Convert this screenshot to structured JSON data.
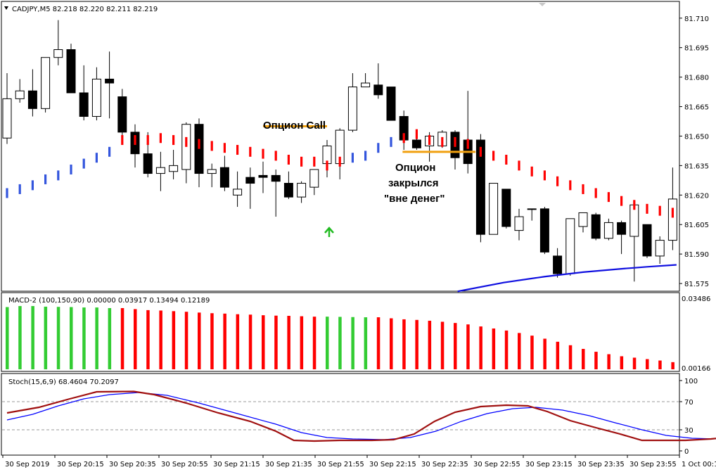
{
  "main": {
    "header": "CADJPY,M5  82.218 82.220 82.211 82.219",
    "menu_icon": "triangle-down-icon",
    "y_ticks": [
      "81.710",
      "81.695",
      "81.680",
      "81.665",
      "81.650",
      "81.635",
      "81.620",
      "81.605",
      "81.590",
      "81.575"
    ],
    "ylim": [
      81.5718,
      81.7178
    ],
    "annotations": {
      "call": "Опцион Call",
      "closed_line1": "Опцион",
      "closed_line2": "закрылся",
      "closed_line3": "\"вне денег\""
    },
    "arrow_icon": "green-up-arrow-icon"
  },
  "macd": {
    "header": "MACD-2 (100,150,90) 0.00000 0.03917 0.13494 0.12189",
    "y_top": "0.03486",
    "y_bottom": "0.00166",
    "colors": {
      "up": "#33cc33",
      "down": "#ff0000"
    }
  },
  "stoch": {
    "header": "Stoch(15,6,9) 68.4604 70.2097",
    "y_ticks": [
      "100",
      "70",
      "30",
      "0"
    ],
    "colors": {
      "main": "#a01010",
      "signal": "#0000ff"
    }
  },
  "time_axis": {
    "labels": [
      "30 Sep 2019",
      "30 Sep 20:15",
      "30 Sep 20:35",
      "30 Sep 20:55",
      "30 Sep 21:15",
      "30 Sep 21:35",
      "30 Sep 21:55",
      "30 Sep 22:15",
      "30 Sep 22:35",
      "30 Sep 22:55",
      "30 Sep 23:15",
      "30 Sep 23:35",
      "30 Sep 23:55",
      "1 Oct 00:1"
    ]
  },
  "chart_data": [
    {
      "type": "candlestick",
      "symbol": "CADJPY",
      "timeframe": "M5",
      "ohlc": [
        [
          81.649,
          81.682,
          81.646,
          81.669
        ],
        [
          81.669,
          81.679,
          81.667,
          81.673
        ],
        [
          81.673,
          81.684,
          81.66,
          81.664
        ],
        [
          81.664,
          81.69,
          81.662,
          81.69
        ],
        [
          81.69,
          81.709,
          81.686,
          81.694
        ],
        [
          81.694,
          81.697,
          81.672,
          81.672
        ],
        [
          81.672,
          81.686,
          81.658,
          81.66
        ],
        [
          81.66,
          81.685,
          81.658,
          81.679
        ],
        [
          81.679,
          81.693,
          81.659,
          81.677
        ],
        [
          81.67,
          81.674,
          81.646,
          81.652
        ],
        [
          81.652,
          81.656,
          81.634,
          81.641
        ],
        [
          81.641,
          81.652,
          81.629,
          81.631
        ],
        [
          81.631,
          81.642,
          81.622,
          81.634
        ],
        [
          81.632,
          81.643,
          81.628,
          81.635
        ],
        [
          81.633,
          81.657,
          81.626,
          81.656
        ],
        [
          81.656,
          81.659,
          81.624,
          81.631
        ],
        [
          81.631,
          81.636,
          81.624,
          81.633
        ],
        [
          81.634,
          81.64,
          81.622,
          81.624
        ],
        [
          81.62,
          81.632,
          81.614,
          81.623
        ],
        [
          81.629,
          81.634,
          81.613,
          81.626
        ],
        [
          81.63,
          81.637,
          81.621,
          81.629
        ],
        [
          81.63,
          81.633,
          81.609,
          81.627
        ],
        [
          81.626,
          81.632,
          81.618,
          81.619
        ],
        [
          81.619,
          81.627,
          81.616,
          81.626
        ],
        [
          81.624,
          81.633,
          81.62,
          81.633
        ],
        [
          81.636,
          81.648,
          81.629,
          81.645
        ],
        [
          81.636,
          81.654,
          81.628,
          81.653
        ],
        [
          81.653,
          81.682,
          81.652,
          81.675
        ],
        [
          81.675,
          81.682,
          81.677,
          81.677
        ],
        [
          81.676,
          81.687,
          81.669,
          81.671
        ],
        [
          81.675,
          81.675,
          81.658,
          81.658
        ],
        [
          81.66,
          81.663,
          81.643,
          81.648
        ],
        [
          81.648,
          81.649,
          81.643,
          81.644
        ],
        [
          81.645,
          81.652,
          81.637,
          81.65
        ],
        [
          81.645,
          81.653,
          81.644,
          81.652
        ],
        [
          81.652,
          81.653,
          81.633,
          81.639
        ],
        [
          81.648,
          81.673,
          81.631,
          81.636
        ],
        [
          81.648,
          81.651,
          81.596,
          81.6
        ],
        [
          81.6,
          81.626,
          81.6,
          81.626
        ],
        [
          81.623,
          81.623,
          81.603,
          81.604
        ],
        [
          81.602,
          81.613,
          81.597,
          81.609
        ],
        [
          81.613,
          81.613,
          81.607,
          81.613
        ],
        [
          81.613,
          81.614,
          81.59,
          81.591
        ],
        [
          81.589,
          81.593,
          81.578,
          81.58
        ],
        [
          81.58,
          81.608,
          81.579,
          81.608
        ],
        [
          81.604,
          81.611,
          81.601,
          81.611
        ],
        [
          81.61,
          81.611,
          81.597,
          81.598
        ],
        [
          81.598,
          81.608,
          81.597,
          81.606
        ],
        [
          81.606,
          81.607,
          81.59,
          81.6
        ],
        [
          81.599,
          81.613,
          81.576,
          81.615
        ],
        [
          81.605,
          81.605,
          81.588,
          81.589
        ],
        [
          81.589,
          81.599,
          81.585,
          81.597
        ],
        [
          81.597,
          81.634,
          81.592,
          81.618
        ]
      ],
      "psar": [
        [
          0,
          81.621
        ],
        [
          1,
          81.623
        ],
        [
          2,
          81.625
        ],
        [
          3,
          81.628
        ],
        [
          4,
          81.63
        ],
        [
          5,
          81.633
        ],
        [
          6,
          81.636
        ],
        [
          7,
          81.639
        ],
        [
          8,
          81.642
        ],
        [
          9,
          81.648
        ],
        [
          10,
          81.648
        ],
        [
          11,
          81.648
        ],
        [
          12,
          81.649
        ],
        [
          13,
          81.648
        ],
        [
          14,
          81.647
        ],
        [
          15,
          81.646
        ],
        [
          16,
          81.645
        ],
        [
          17,
          81.644
        ],
        [
          18,
          81.643
        ],
        [
          19,
          81.642
        ],
        [
          20,
          81.641
        ],
        [
          21,
          81.64
        ],
        [
          22,
          81.638
        ],
        [
          23,
          81.637
        ],
        [
          24,
          81.637
        ],
        [
          25,
          81.635
        ],
        [
          26,
          81.637
        ],
        [
          27,
          81.639
        ],
        [
          28,
          81.64
        ],
        [
          29,
          81.644
        ],
        [
          30,
          81.647
        ],
        [
          31,
          81.649
        ],
        [
          32,
          81.651
        ],
        [
          33,
          81.648
        ],
        [
          34,
          81.647
        ],
        [
          35,
          81.647
        ],
        [
          36,
          81.646
        ],
        [
          37,
          81.642
        ],
        [
          38,
          81.64
        ],
        [
          39,
          81.638
        ],
        [
          40,
          81.635
        ],
        [
          41,
          81.632
        ],
        [
          42,
          81.63
        ],
        [
          43,
          81.627
        ],
        [
          44,
          81.625
        ],
        [
          45,
          81.623
        ],
        [
          46,
          81.621
        ],
        [
          47,
          81.619
        ],
        [
          48,
          81.617
        ],
        [
          49,
          81.615
        ],
        [
          50,
          81.613
        ],
        [
          51,
          81.612
        ],
        [
          52,
          81.611
        ]
      ],
      "psar_colors": {
        "below": "#3355dd",
        "above": "#ff0000"
      },
      "blue_line": [
        [
          35.2,
          81.571
        ],
        [
          38.8,
          81.5755
        ],
        [
          42,
          81.5785
        ],
        [
          45,
          81.5808
        ],
        [
          48,
          81.5825
        ],
        [
          50,
          81.5835
        ],
        [
          52.3,
          81.5845
        ]
      ],
      "annotation_levels": {
        "call_line": 81.655,
        "closed_line": 81.642
      },
      "annotation_bars": {
        "call": [
          20,
          25
        ],
        "closed": [
          30.9,
          36.6
        ]
      }
    },
    {
      "type": "bar",
      "name": "MACD-2",
      "params": "(100,150,90)",
      "values": [
        0.0305,
        0.031,
        0.031,
        0.0307,
        0.0306,
        0.0305,
        0.0303,
        0.0303,
        0.03,
        0.03,
        0.0295,
        0.029,
        0.0288,
        0.0285,
        0.0282,
        0.0278,
        0.0275,
        0.0273,
        0.027,
        0.0268,
        0.0265,
        0.0263,
        0.0262,
        0.026,
        0.0258,
        0.0258,
        0.0257,
        0.0256,
        0.0255,
        0.0255,
        0.025,
        0.0245,
        0.0242,
        0.0238,
        0.0233,
        0.0227,
        0.022,
        0.021,
        0.02,
        0.019,
        0.0178,
        0.0165,
        0.015,
        0.0135,
        0.0118,
        0.01,
        0.0086,
        0.0074,
        0.0064,
        0.0057,
        0.005,
        0.0043,
        0.0035
      ],
      "colors": [
        "up",
        "up",
        "up",
        "up",
        "up",
        "up",
        "up",
        "up",
        "up",
        "down",
        "down",
        "down",
        "down",
        "down",
        "down",
        "down",
        "down",
        "down",
        "down",
        "down",
        "down",
        "down",
        "down",
        "down",
        "down",
        "up",
        "up",
        "up",
        "up",
        "down",
        "down",
        "down",
        "down",
        "down",
        "down",
        "down",
        "down",
        "down",
        "down",
        "down",
        "down",
        "down",
        "down",
        "down",
        "down",
        "down",
        "down",
        "down",
        "down",
        "down",
        "down",
        "down",
        "down"
      ],
      "ylim": [
        0,
        0.0362
      ]
    },
    {
      "type": "line",
      "name": "Stoch(15,6,9)",
      "ylim": [
        0,
        100
      ],
      "levels": [
        70,
        30
      ],
      "series": [
        {
          "values": [
            [
              0,
              54
            ],
            [
              2.5,
              62
            ],
            [
              4.9,
              74
            ],
            [
              7,
              84
            ],
            [
              9.9,
              84.5
            ],
            [
              11.5,
              80
            ],
            [
              14,
              68
            ],
            [
              16.5,
              54
            ],
            [
              19,
              42
            ],
            [
              21,
              28
            ],
            [
              22.4,
              15
            ],
            [
              24,
              14
            ],
            [
              26,
              15
            ],
            [
              28.5,
              15
            ],
            [
              30.2,
              16
            ],
            [
              31.8,
              24
            ],
            [
              33.4,
              42
            ],
            [
              35,
              55
            ],
            [
              37,
              63
            ],
            [
              39,
              65
            ],
            [
              40.7,
              64
            ],
            [
              42.2,
              56
            ],
            [
              44,
              43
            ],
            [
              46,
              33
            ],
            [
              47.7,
              25
            ],
            [
              49.6,
              15
            ],
            [
              51.4,
              15
            ],
            [
              53,
              15
            ],
            [
              55,
              17
            ],
            [
              57,
              21
            ],
            [
              59.5,
              24
            ],
            [
              61.5,
              29
            ]
          ]
        },
        {
          "values": [
            [
              0,
              44
            ],
            [
              2,
              52
            ],
            [
              4,
              64
            ],
            [
              6,
              74
            ],
            [
              8,
              80
            ],
            [
              10.3,
              83
            ],
            [
              12.5,
              79
            ],
            [
              15,
              68
            ],
            [
              18,
              53
            ],
            [
              21,
              38
            ],
            [
              23,
              26
            ],
            [
              25,
              19
            ],
            [
              27,
              17
            ],
            [
              29.5,
              16
            ],
            [
              31.5,
              19
            ],
            [
              33.5,
              28
            ],
            [
              35.5,
              42
            ],
            [
              37.5,
              53
            ],
            [
              39.5,
              60
            ],
            [
              41.3,
              62
            ],
            [
              43.4,
              58
            ],
            [
              45.5,
              50
            ],
            [
              47.5,
              40
            ],
            [
              49.6,
              30
            ],
            [
              51.5,
              22
            ],
            [
              53.5,
              18
            ],
            [
              55.5,
              17
            ],
            [
              57.5,
              17
            ],
            [
              59.5,
              18
            ],
            [
              61.5,
              20
            ]
          ]
        }
      ]
    }
  ]
}
